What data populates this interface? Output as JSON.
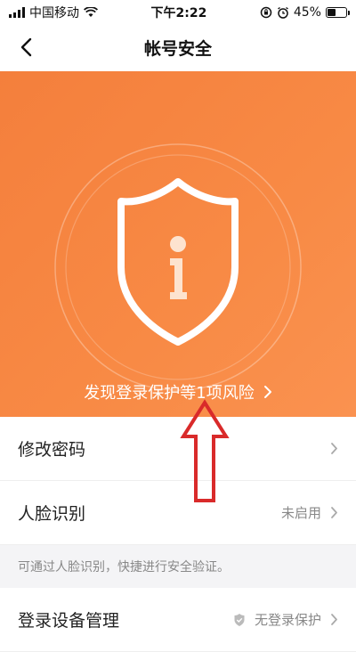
{
  "status_bar": {
    "carrier": "中国移动",
    "time": "下午2:22",
    "battery": "45%",
    "battery_level": 0.45
  },
  "nav": {
    "title": "帐号安全",
    "back_icon": "chevron-left-icon"
  },
  "hero": {
    "icon": "shield-info-icon",
    "risk_text": "发现登录保护等1项风险",
    "risk_chevron": "chevron-right-icon",
    "background": "#f6853f"
  },
  "list": {
    "change_password": {
      "label": "修改密码"
    },
    "face_recognition": {
      "label": "人脸识别",
      "value": "未启用"
    },
    "face_hint": "可通过人脸识别，快捷进行安全验证。",
    "device_management": {
      "label": "登录设备管理",
      "value": "无登录保护"
    }
  },
  "annotation": {
    "color": "#d92a2a",
    "shape": "up-arrow"
  }
}
